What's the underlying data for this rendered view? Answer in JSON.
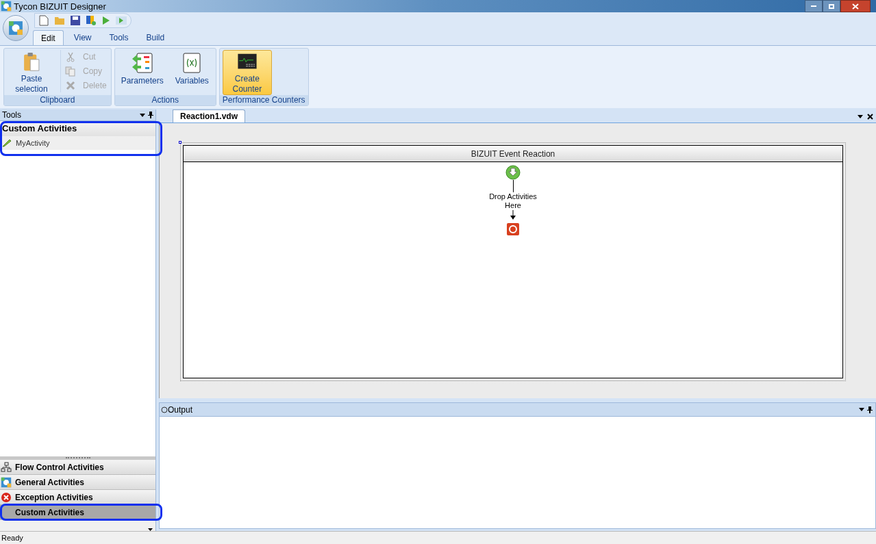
{
  "window": {
    "title": "Tycon BIZUIT Designer"
  },
  "ribbon_tabs": [
    {
      "label": "Edit",
      "selected": true
    },
    {
      "label": "View",
      "selected": false
    },
    {
      "label": "Tools",
      "selected": false
    },
    {
      "label": "Build",
      "selected": false
    }
  ],
  "ribbon_groups": [
    {
      "label": "Clipboard",
      "buttons": [
        {
          "label": "Paste selection",
          "kind": "large",
          "disabled": false,
          "selected": false
        },
        {
          "label": "Cut",
          "kind": "small",
          "disabled": true,
          "selected": false
        },
        {
          "label": "Copy",
          "kind": "small",
          "disabled": true,
          "selected": false
        },
        {
          "label": "Delete",
          "kind": "small",
          "disabled": true,
          "selected": false
        }
      ]
    },
    {
      "label": "Actions",
      "buttons": [
        {
          "label": "Parameters",
          "kind": "large",
          "disabled": false,
          "selected": false
        },
        {
          "label": "Variables",
          "kind": "large",
          "disabled": false,
          "selected": false
        }
      ]
    },
    {
      "label": "Performance Counters",
      "buttons": [
        {
          "label": "Create Counter",
          "kind": "large",
          "disabled": false,
          "selected": true
        }
      ]
    }
  ],
  "tools_panel": {
    "title": "Tools",
    "expanded_group": {
      "title": "Custom Activities",
      "items": [
        {
          "label": "MyActivity"
        }
      ]
    },
    "groups": [
      {
        "label": "Flow Control Activities",
        "selected": false
      },
      {
        "label": "General Activities",
        "selected": false
      },
      {
        "label": "Exception Activities",
        "selected": false
      },
      {
        "label": "Custom Activities",
        "selected": true
      }
    ]
  },
  "document_tabs": [
    {
      "label": "Reaction1.vdw",
      "selected": true
    }
  ],
  "workflow": {
    "title": "BIZUIT Event Reaction",
    "drop_hint": "Drop Activities Here"
  },
  "output_panel": {
    "title": "Output"
  },
  "status_bar": {
    "text": "Ready"
  }
}
